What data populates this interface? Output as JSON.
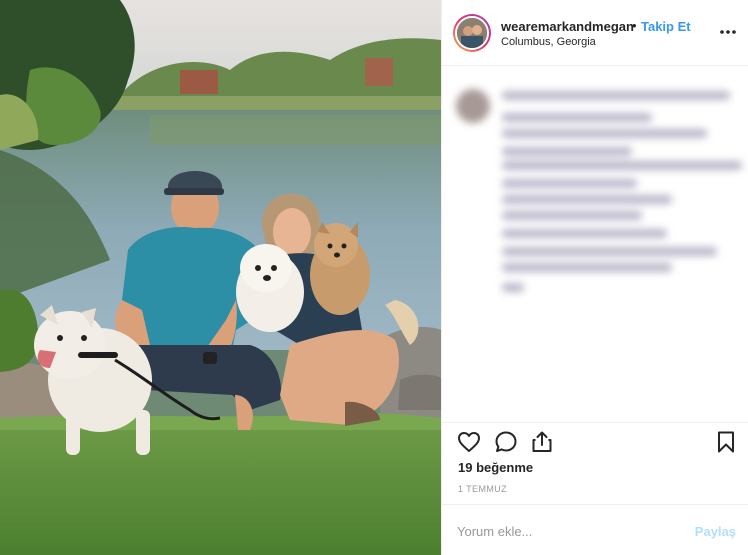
{
  "post": {
    "username": "wearemarkandmegan",
    "separator": "•",
    "follow_label": "Takip Et",
    "location": "Columbus, Georgia",
    "likes_text": "19 beğenme",
    "date": "1 TEMMUZ",
    "comment_placeholder": "Yorum ekle...",
    "share_label": "Paylaş"
  },
  "icons": {
    "more": "more-options-icon",
    "like": "heart-icon",
    "comment": "comment-icon",
    "share": "share-icon",
    "save": "bookmark-icon"
  },
  "colors": {
    "link_blue": "#3897f0",
    "disabled_blue": "#b2dffc",
    "border": "#efefef",
    "text": "#262626",
    "muted": "#999999"
  }
}
